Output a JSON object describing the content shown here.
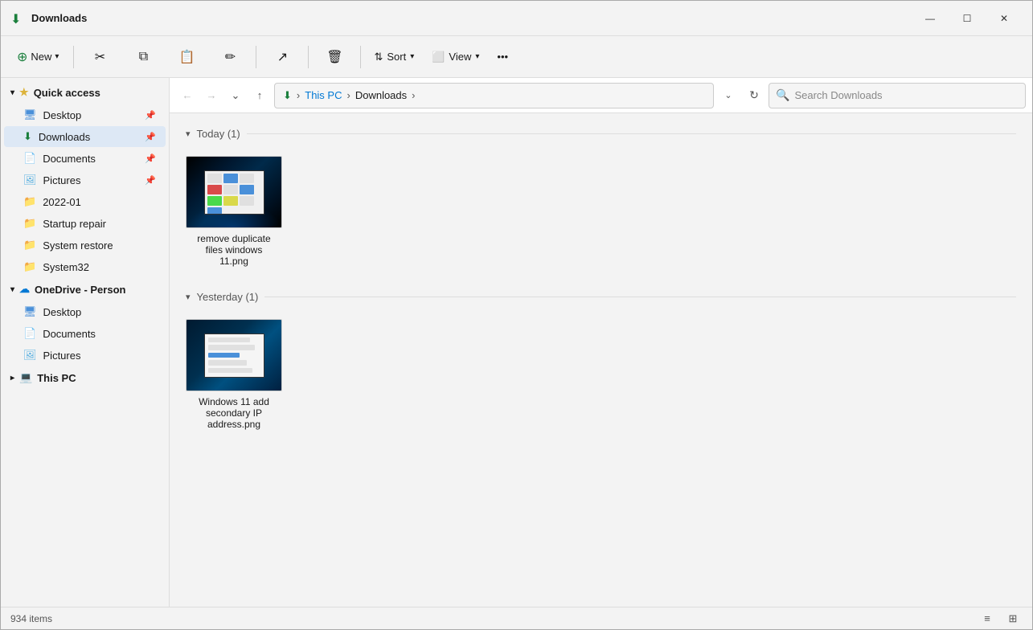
{
  "titleBar": {
    "title": "Downloads",
    "icon": "⬇",
    "minimize": "—",
    "maximize": "☐",
    "close": "✕"
  },
  "toolbar": {
    "newLabel": "New",
    "newIcon": "⊕",
    "cutIcon": "✂",
    "copyIcon": "⧉",
    "pasteIcon": "📋",
    "renameIcon": "✏",
    "shareIcon": "↗",
    "deleteIcon": "🗑",
    "sortLabel": "Sort",
    "sortIcon": "⇅",
    "viewLabel": "View",
    "viewIcon": "⬜",
    "moreIcon": "•••"
  },
  "navBar": {
    "backIcon": "←",
    "forwardIcon": "→",
    "recentIcon": "⌄",
    "upIcon": "↑",
    "pathIcon": "⬇",
    "pathItems": [
      "This PC",
      "Downloads"
    ],
    "pathSeps": [
      ">",
      ">",
      ">"
    ],
    "dropdownIcon": "⌄",
    "refreshIcon": "↻",
    "searchPlaceholder": "Search Downloads"
  },
  "sidebar": {
    "quickAccessLabel": "Quick access",
    "quickAccessIcon": "★",
    "items": [
      {
        "label": "Desktop",
        "icon": "🖥",
        "pinned": true,
        "type": "desktop"
      },
      {
        "label": "Downloads",
        "icon": "⬇",
        "pinned": true,
        "type": "downloads",
        "active": true
      },
      {
        "label": "Documents",
        "icon": "📄",
        "pinned": true,
        "type": "documents"
      },
      {
        "label": "Pictures",
        "icon": "🖼",
        "pinned": true,
        "type": "pictures"
      },
      {
        "label": "2022-01",
        "icon": "📁",
        "pinned": false,
        "type": "folder"
      },
      {
        "label": "Startup repair",
        "icon": "📁",
        "pinned": false,
        "type": "folder"
      },
      {
        "label": "System restore",
        "icon": "📁",
        "pinned": false,
        "type": "folder"
      },
      {
        "label": "System32",
        "icon": "📁",
        "pinned": false,
        "type": "folder"
      }
    ],
    "oneDriveLabel": "OneDrive - Person",
    "oneDriveIcon": "☁",
    "oneDriveItems": [
      {
        "label": "Desktop",
        "icon": "🖥",
        "type": "desktop"
      },
      {
        "label": "Documents",
        "icon": "📄",
        "type": "documents"
      },
      {
        "label": "Pictures",
        "icon": "🖼",
        "type": "pictures"
      }
    ],
    "thisPcLabel": "This PC",
    "thisPcIcon": "💻"
  },
  "content": {
    "groups": [
      {
        "label": "Today (1)",
        "collapsed": false,
        "files": [
          {
            "name": "remove duplicate files windows 11.png",
            "type": "image"
          }
        ]
      },
      {
        "label": "Yesterday (1)",
        "collapsed": false,
        "files": [
          {
            "name": "Windows 11 add secondary IP address.png",
            "type": "image"
          }
        ]
      }
    ]
  },
  "statusBar": {
    "itemCount": "934 items",
    "listViewIcon": "≡",
    "gridViewIcon": "⊞"
  }
}
